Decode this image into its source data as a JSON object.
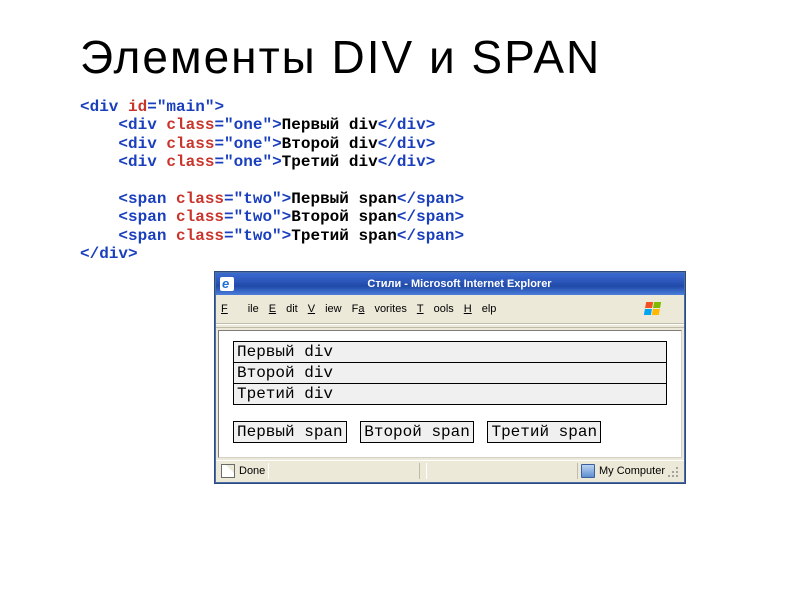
{
  "title": "Элементы DIV и SPAN",
  "code": {
    "l1_open": "<div ",
    "l1_attr": "id",
    "l1_val": "\"main\"",
    "l1_close": ">",
    "d_open": "<div ",
    "d_attr": "class",
    "d_val": "\"one\"",
    "d_mid": ">",
    "d1_txt": "Первый div",
    "d2_txt": "Второй div",
    "d3_txt": "Третий div",
    "d_close": "</div>",
    "s_open": "<span ",
    "s_attr": "class",
    "s_val": "\"two\"",
    "s_mid": ">",
    "s1_txt": "Первый span",
    "s2_txt": "Второй span",
    "s3_txt": "Третий span",
    "s_close": "</span>",
    "end": "</div>"
  },
  "ie": {
    "title": "Стили - Microsoft Internet Explorer",
    "menu": {
      "file": "File",
      "edit": "Edit",
      "view": "View",
      "favorites": "Favorites",
      "tools": "Tools",
      "help": "Help"
    },
    "content": {
      "div1": "Первый div",
      "div2": "Второй div",
      "div3": "Третий div",
      "span1": "Первый span",
      "span2": "Второй span",
      "span3": "Третий span"
    },
    "status": {
      "done": "Done",
      "zone": "My Computer"
    }
  }
}
